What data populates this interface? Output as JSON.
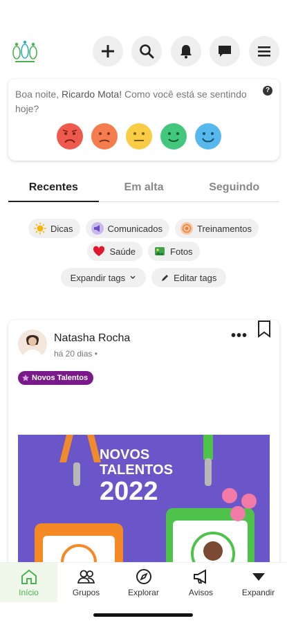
{
  "header": {
    "logo_alt": "Talento Lopes logo",
    "buttons": [
      {
        "name": "add-button",
        "icon": "plus-icon"
      },
      {
        "name": "search-button",
        "icon": "search-icon"
      },
      {
        "name": "notifications-button",
        "icon": "bell-icon"
      },
      {
        "name": "messages-button",
        "icon": "chat-icon"
      },
      {
        "name": "menu-button",
        "icon": "hamburger-icon"
      }
    ]
  },
  "mood": {
    "greeting_prefix": "Boa noite,",
    "user_name": "Ricardo Mota!",
    "question": "Como você está se sentindo hoje?",
    "help_icon": "?",
    "faces": [
      {
        "name": "very-sad",
        "color": "#ef5a4f"
      },
      {
        "name": "sad",
        "color": "#f57c4f"
      },
      {
        "name": "neutral",
        "color": "#f8cc44"
      },
      {
        "name": "happy",
        "color": "#43c77d"
      },
      {
        "name": "very-happy",
        "color": "#56b8ec"
      }
    ]
  },
  "tabs": [
    {
      "label": "Recentes",
      "active": true
    },
    {
      "label": "Em alta",
      "active": false
    },
    {
      "label": "Seguindo",
      "active": false
    }
  ],
  "tags": {
    "row1": [
      {
        "label": "Dicas",
        "icon": "sun-icon"
      },
      {
        "label": "Comunicados",
        "icon": "megaphone-icon"
      },
      {
        "label": "Treinamentos",
        "icon": "target-icon"
      }
    ],
    "row2": [
      {
        "label": "Saúde",
        "icon": "heart-icon"
      },
      {
        "label": "Fotos",
        "icon": "photo-icon"
      }
    ],
    "expand_label": "Expandir tags",
    "edit_label": "Editar tags"
  },
  "post": {
    "author": "Natasha Rocha",
    "time": "há 20 dias •",
    "more": "•••",
    "tag": "Novos Talentos",
    "banner": {
      "line1": "NOVOS",
      "line2": "TALENTOS",
      "year": "2022"
    }
  },
  "nav": [
    {
      "label": "Início",
      "icon": "home-icon",
      "active": true
    },
    {
      "label": "Grupos",
      "icon": "groups-icon",
      "active": false
    },
    {
      "label": "Explorar",
      "icon": "compass-icon",
      "active": false
    },
    {
      "label": "Avisos",
      "icon": "megaphone-icon",
      "active": false
    },
    {
      "label": "Expandir",
      "icon": "triangle-down-icon",
      "active": false
    }
  ],
  "colors": {
    "accent": "#4caf50",
    "banner": "#6a55c9",
    "tag": "#7a1a8a"
  }
}
